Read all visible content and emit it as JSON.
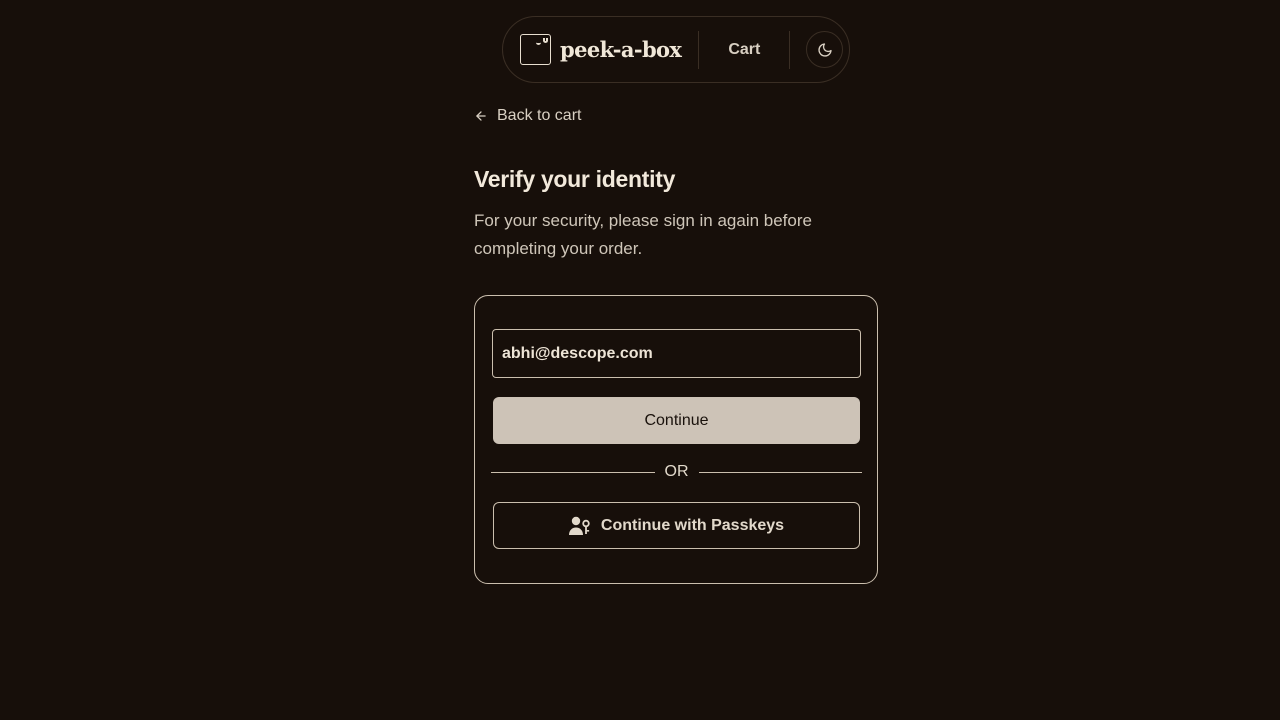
{
  "header": {
    "brand": "peek-a-box",
    "cart_label": "Cart",
    "theme_icon": "moon-icon"
  },
  "back_link": {
    "label": "Back to cart",
    "icon": "arrow-left-icon"
  },
  "verify": {
    "title": "Verify your identity",
    "subtitle": "For your security, please sign in again before completing your order."
  },
  "form": {
    "email_value": "abhi@descope.com",
    "continue_label": "Continue",
    "or_label": "OR",
    "passkeys_label": "Continue with Passkeys",
    "passkeys_icon": "user-key-icon"
  },
  "colors": {
    "background": "#170f0a",
    "primary_button": "#cdc3b7",
    "border": "#cbbfae",
    "text": "#ede4d6"
  }
}
